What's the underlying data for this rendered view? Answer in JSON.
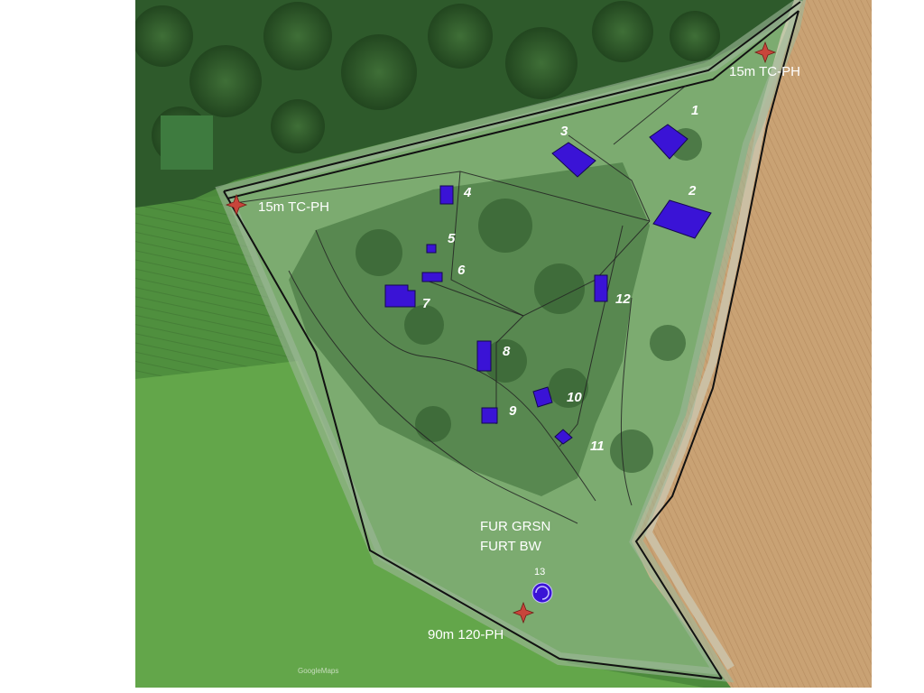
{
  "map": {
    "watermark": "GoogleMaps",
    "colors": {
      "forest_dark": "#2f5a2c",
      "field_green": "#5b9a45",
      "field_wheat": "#c9a274",
      "overlay": "#a9c6a2",
      "building": "#3a13d6",
      "marker": "#c8453b",
      "boundary": "#111111"
    },
    "buildings": [
      {
        "id": "b1",
        "label": "1"
      },
      {
        "id": "b2",
        "label": "2"
      },
      {
        "id": "b3",
        "label": "3"
      },
      {
        "id": "b4",
        "label": "4"
      },
      {
        "id": "b5",
        "label": "5"
      },
      {
        "id": "b6",
        "label": "6"
      },
      {
        "id": "b7",
        "label": "7"
      },
      {
        "id": "b8",
        "label": "8"
      },
      {
        "id": "b9",
        "label": "9"
      },
      {
        "id": "b10",
        "label": "10"
      },
      {
        "id": "b11",
        "label": "11"
      },
      {
        "id": "b12",
        "label": "12"
      },
      {
        "id": "b13",
        "label": "13"
      }
    ],
    "markers": [
      {
        "id": "m-ne",
        "label": "15m TC-PH",
        "icon": "star-icon"
      },
      {
        "id": "m-w",
        "label": "15m TC-PH",
        "icon": "star-icon"
      },
      {
        "id": "m-s",
        "label": "90m 120-PH",
        "icon": "star-icon"
      }
    ],
    "site_labels": {
      "line1": "FUR GRSN",
      "line2": "FURT BW"
    }
  }
}
